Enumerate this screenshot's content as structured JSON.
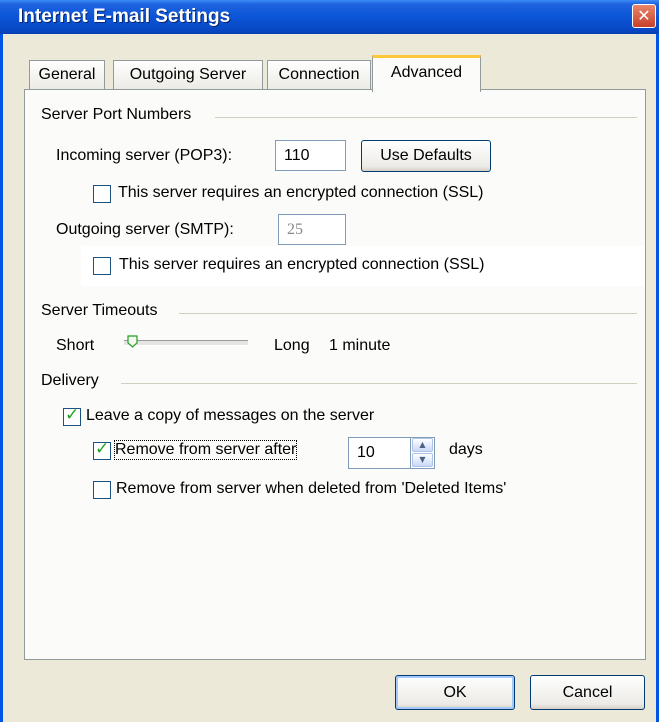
{
  "window": {
    "title": "Internet E-mail Settings",
    "close_glyph": "✕"
  },
  "tabs": [
    {
      "label": "General"
    },
    {
      "label": "Outgoing Server"
    },
    {
      "label": "Connection"
    },
    {
      "label": "Advanced",
      "selected": true
    }
  ],
  "server_ports": {
    "heading": "Server Port Numbers",
    "incoming_label": "Incoming server (POP3):",
    "incoming_value": "110",
    "use_defaults": "Use Defaults",
    "incoming_ssl_label": "This server requires an encrypted connection (SSL)",
    "incoming_ssl_checked": false,
    "outgoing_label": "Outgoing server (SMTP):",
    "outgoing_value": "25",
    "outgoing_ssl_label": "This server requires an encrypted connection (SSL)",
    "outgoing_ssl_checked": false
  },
  "timeouts": {
    "heading": "Server Timeouts",
    "short_label": "Short",
    "long_label": "Long",
    "value_label": "1 minute",
    "slider_position_fraction": 0.05
  },
  "delivery": {
    "heading": "Delivery",
    "leave_copy_label": "Leave a copy of messages on the server",
    "leave_copy_checked": true,
    "remove_after_label": "Remove from server after",
    "remove_after_checked": true,
    "remove_after_value": "10",
    "days_label": "days",
    "remove_deleted_label": "Remove from server when deleted from 'Deleted Items'",
    "remove_deleted_checked": false
  },
  "footer": {
    "ok": "OK",
    "cancel": "Cancel"
  },
  "icons": {
    "check": "✓",
    "spin_up": "▲",
    "spin_down": "▼"
  },
  "colors": {
    "title_bar": "#0a55d6",
    "dialog_face": "#ece9d8",
    "active_tab_accent": "#ffc83c",
    "checkmark": "#21a121"
  }
}
